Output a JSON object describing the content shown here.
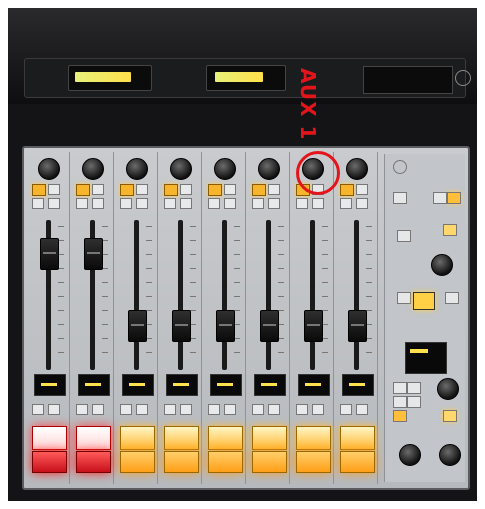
{
  "annotation": {
    "text": "AUX 1",
    "color": "#e3151b"
  },
  "channels": [
    {
      "on_color": "#ffb935",
      "off_color": "#ff9e18",
      "fader_level": 0.85
    },
    {
      "on_color": "#ffb935",
      "off_color": "#ff9e18",
      "fader_level": 0.85
    },
    {
      "on_color": "#ffb935",
      "off_color": "#ff9e18",
      "fader_level": 0.25
    },
    {
      "on_color": "#ffb935",
      "off_color": "#ff9e18",
      "fader_level": 0.25
    },
    {
      "on_color": "#ffb935",
      "off_color": "#ff9e18",
      "fader_level": 0.25
    },
    {
      "on_color": "#ffb935",
      "off_color": "#ff9e18",
      "fader_level": 0.25
    },
    {
      "on_color": "#ffb935",
      "off_color": "#ff9e18",
      "fader_level": 0.25
    },
    {
      "on_color": "#ffb935",
      "off_color": "#ff9e18",
      "fader_level": 0.25
    }
  ],
  "colors": {
    "channel_button_red": "#c8101a",
    "display_text": "#ffe14f",
    "panel": "#c2c5c9"
  }
}
